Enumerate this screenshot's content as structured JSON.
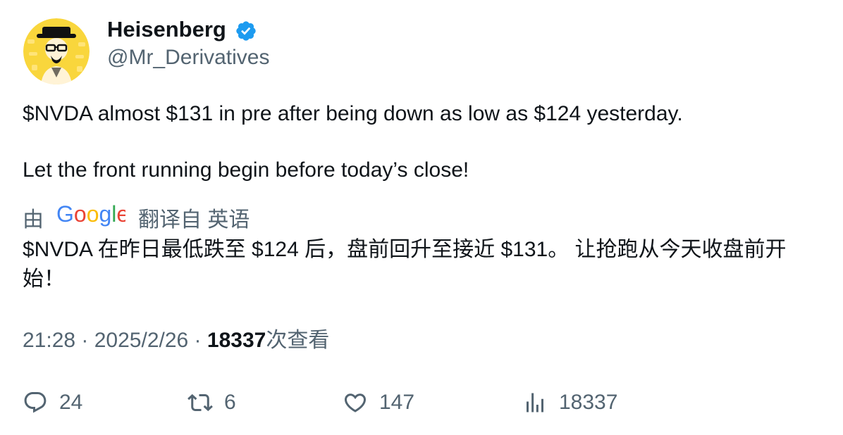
{
  "author": {
    "display_name": "Heisenberg",
    "handle": "@Mr_Derivatives",
    "verified": true
  },
  "tweet": {
    "line1": "$NVDA almost $131 in pre after being down as low as $124 yesterday.",
    "line2": "Let the front running begin before today’s close!"
  },
  "translation": {
    "prefix": "由",
    "provider": "Google",
    "suffix": "翻译自 英语",
    "text": "$NVDA 在昨日最低跌至 $124 后，盘前回升至接近 $131。 让抢跑从今天收盘前开始！"
  },
  "meta": {
    "time": "21:28",
    "sep1": " · ",
    "date": "2025/2/26",
    "sep2": " · ",
    "views_count": "18337",
    "views_label": "次查看"
  },
  "actions": {
    "replies": "24",
    "retweets": "6",
    "likes": "147",
    "views": "18337"
  },
  "colors": {
    "text_primary": "#0f1419",
    "text_secondary": "#536471",
    "verified_blue": "#1d9bf0",
    "avatar_yellow": "#f9d63c"
  }
}
